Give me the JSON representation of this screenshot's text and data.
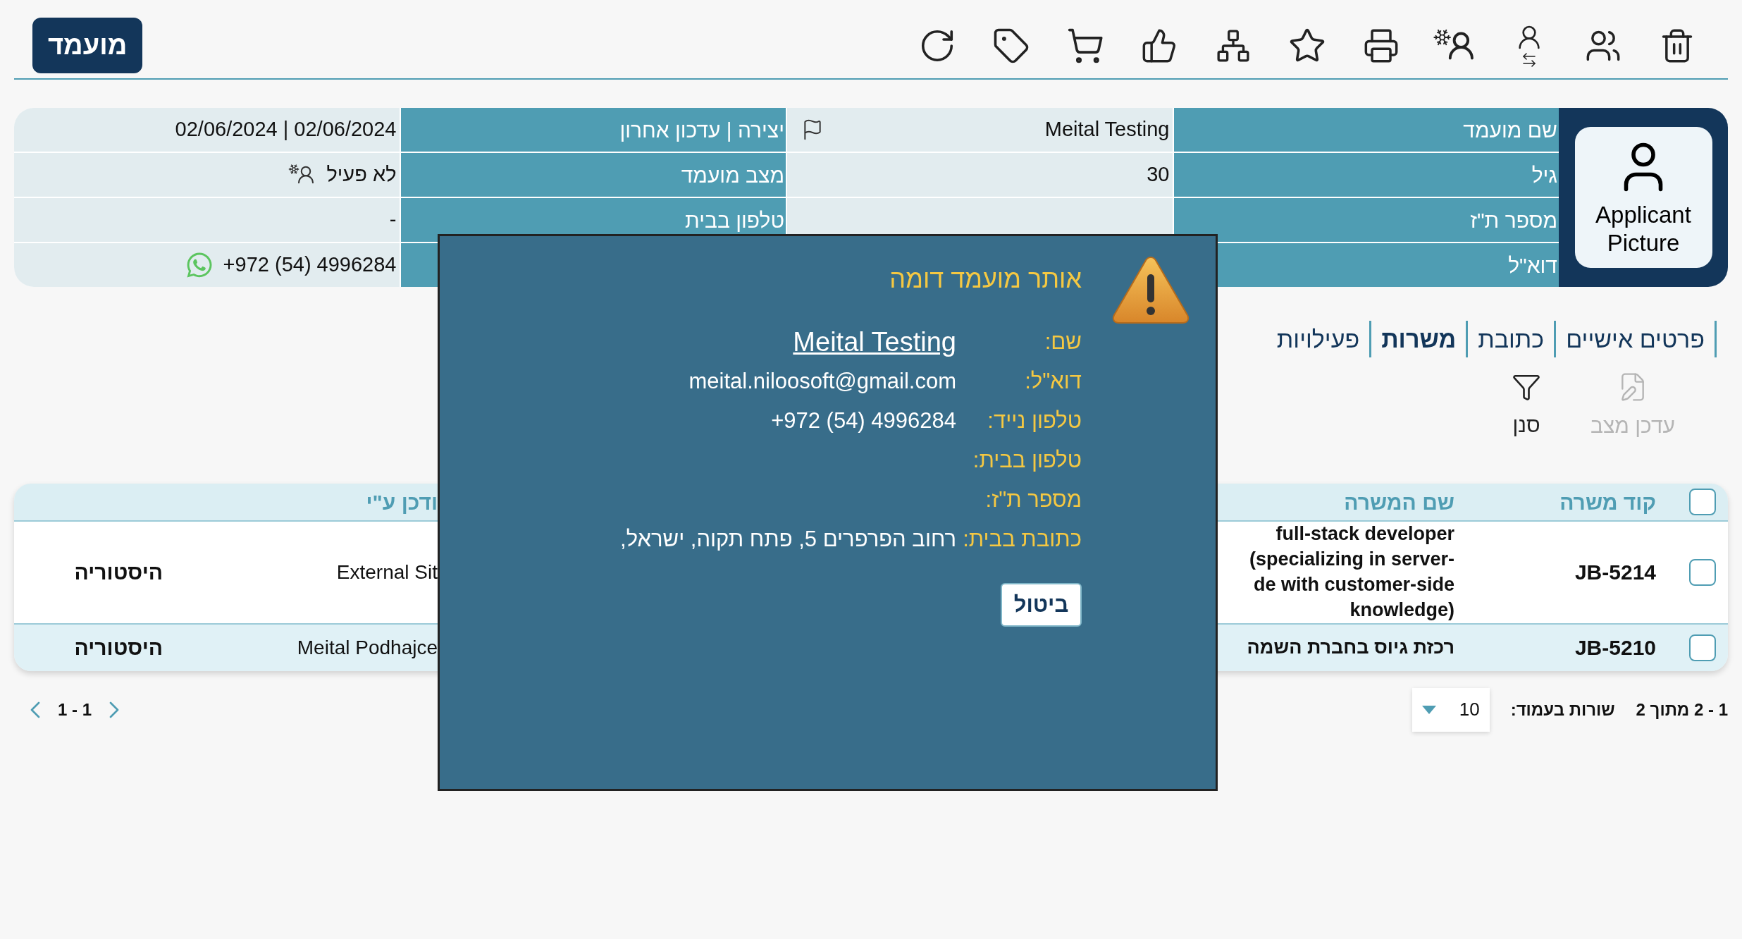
{
  "header": {
    "logo": "מועמד"
  },
  "summary": {
    "picture_label": "Applicant Picture",
    "rows": [
      {
        "cells": [
          {
            "label": "שם מועמד",
            "value": "Meital Testing",
            "kind": "flagged"
          },
          {
            "label": "יצירה | עדכון אחרון",
            "value": "02/06/2024 | 02/06/2024",
            "kind": "text"
          }
        ]
      },
      {
        "cells": [
          {
            "label": "גיל",
            "value": "30",
            "kind": "text"
          },
          {
            "label": "מצב מועמד",
            "value": "לא פעיל",
            "kind": "status"
          }
        ]
      },
      {
        "cells": [
          {
            "label": "מספר ת\"ז",
            "kind": "text"
          },
          {
            "label": "טלפון בבית",
            "value": "-",
            "kind": "text"
          }
        ]
      },
      {
        "cells": [
          {
            "label": "דוא\"ל",
            "kind": "text"
          },
          {
            "value": "+972 (54) 4996284",
            "kind": "phone"
          }
        ]
      }
    ]
  },
  "tabs": [
    {
      "label": "פרטים אישיים",
      "selected": false
    },
    {
      "label": "כתובת",
      "selected": false
    },
    {
      "label": "משרות",
      "selected": true
    },
    {
      "label": "פעילויות",
      "selected": false
    }
  ],
  "actions": [
    {
      "label": "עדכן מצב",
      "kind": "status",
      "disabled": true
    },
    {
      "label": "סנן",
      "kind": "filter",
      "disabled": false
    }
  ],
  "job_table": {
    "all_checked": false,
    "columns": [
      "קוד משרה",
      "שם המשרה",
      "ודכן ע\"י"
    ],
    "rows": [
      {
        "checked": false,
        "highlighted": false,
        "code": "JB-5214",
        "title": [
          "full-stack developer",
          "(specializing in server-",
          "de with customer-side",
          "knowledge)"
        ],
        "updated_by": "External Sit",
        "history": "היסטוריה"
      },
      {
        "checked": false,
        "highlighted": true,
        "code": "JB-5210",
        "title": [
          "רכזת גיוס בחברת השמה"
        ],
        "updated_by": "Meital Podhajce",
        "history": "היסטוריה"
      }
    ]
  },
  "pagination": {
    "range": "1 - 2 מתוך 2",
    "rows_label": "שורות בעמוד:",
    "rows_per_page": "10",
    "pages": "1 - 1"
  },
  "dialog": {
    "title": "אותר מועמד דומה",
    "fields": [
      {
        "label": "שם:",
        "value": "Meital Testing",
        "kind": "link"
      },
      {
        "label": "דוא\"ל:",
        "value": "meital.niloosoft@gmail.com",
        "kind": "text"
      },
      {
        "label": "טלפון נייד:",
        "value": "+972 (54) 4996284",
        "kind": "text"
      },
      {
        "label": "טלפון בבית:"
      },
      {
        "label": "מספר ת\"ז:"
      },
      {
        "label": "כתובת בבית:",
        "value": "רחוב הפרפרים 5, פתח תקוה, ישראל,",
        "kind": "text"
      }
    ],
    "button": "ביטול"
  }
}
